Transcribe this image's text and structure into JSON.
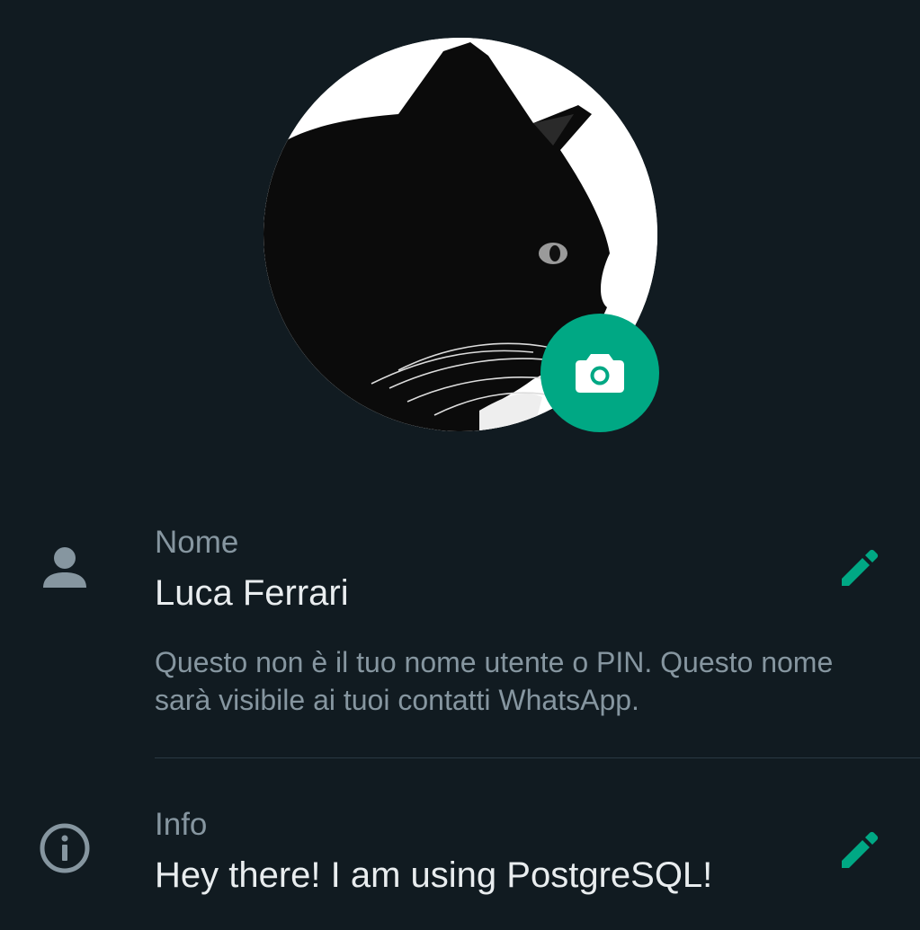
{
  "profile": {
    "photo_icon": "cat-photo",
    "camera_icon": "camera-icon"
  },
  "name_row": {
    "icon": "person-icon",
    "label": "Nome",
    "value": "Luca Ferrari",
    "hint": "Questo non è il tuo nome utente o PIN. Questo nome sarà visibile ai tuoi contatti WhatsApp.",
    "edit_icon": "pencil-icon"
  },
  "info_row": {
    "icon": "info-icon",
    "label": "Info",
    "value": "Hey there! I am using PostgreSQL!",
    "edit_icon": "pencil-icon"
  },
  "colors": {
    "background": "#111b21",
    "accent": "#00a884",
    "primary_text": "#e9edef",
    "secondary_text": "#8696a0"
  }
}
